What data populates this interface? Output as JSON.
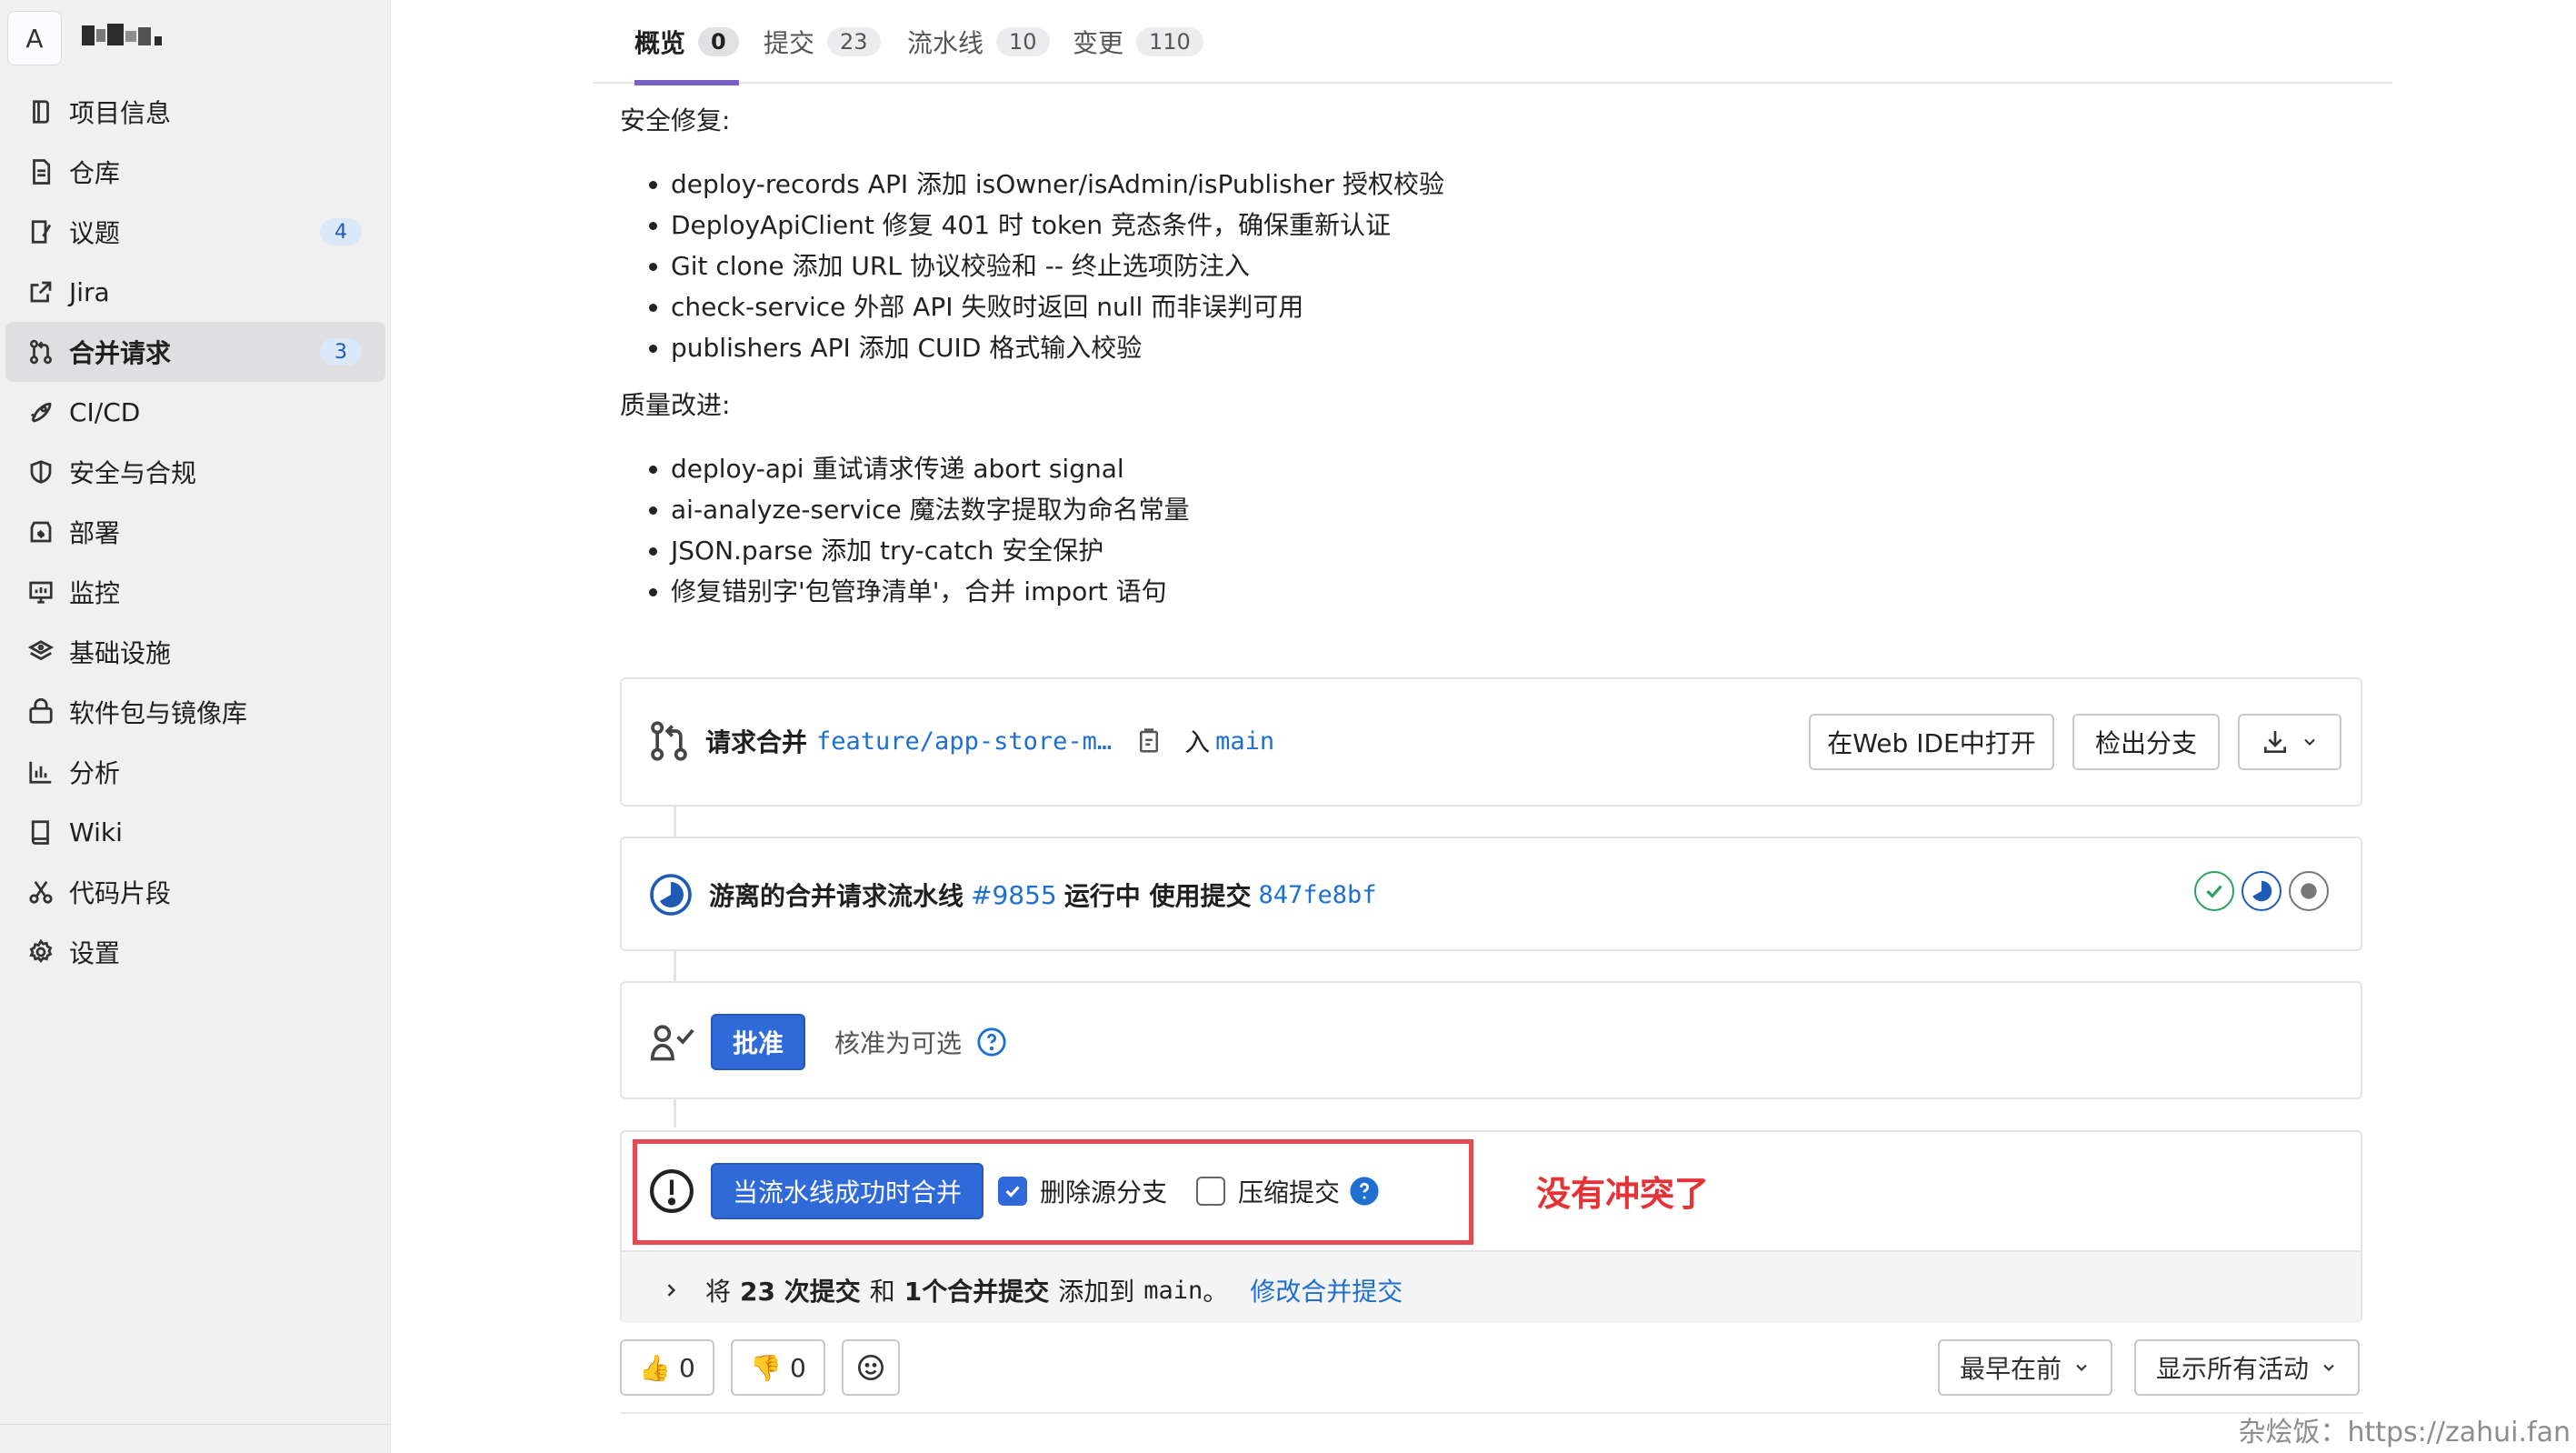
{
  "project": {
    "avatar_letter": "A"
  },
  "sidebar": {
    "items": [
      {
        "label": "项目信息",
        "icon": "project-info-icon"
      },
      {
        "label": "仓库",
        "icon": "repository-icon"
      },
      {
        "label": "议题",
        "icon": "issues-icon",
        "badge": "4"
      },
      {
        "label": "Jira",
        "icon": "external-link-icon"
      },
      {
        "label": "合并请求",
        "icon": "merge-request-icon",
        "badge": "3",
        "active": true
      },
      {
        "label": "CI/CD",
        "icon": "rocket-icon"
      },
      {
        "label": "安全与合规",
        "icon": "shield-icon"
      },
      {
        "label": "部署",
        "icon": "deployments-icon"
      },
      {
        "label": "监控",
        "icon": "monitor-icon"
      },
      {
        "label": "基础设施",
        "icon": "infrastructure-icon"
      },
      {
        "label": "软件包与镜像库",
        "icon": "package-icon"
      },
      {
        "label": "分析",
        "icon": "chart-icon"
      },
      {
        "label": "Wiki",
        "icon": "book-icon"
      },
      {
        "label": "代码片段",
        "icon": "scissors-icon"
      },
      {
        "label": "设置",
        "icon": "gear-icon"
      }
    ]
  },
  "tabs": [
    {
      "label": "概览",
      "count": "0",
      "active": true
    },
    {
      "label": "提交",
      "count": "23"
    },
    {
      "label": "流水线",
      "count": "10"
    },
    {
      "label": "变更",
      "count": "110"
    }
  ],
  "description": {
    "section1_title": "安全修复:",
    "section1_items": [
      "deploy-records API 添加 isOwner/isAdmin/isPublisher 授权校验",
      "DeployApiClient 修复 401 时 token 竞态条件，确保重新认证",
      "Git clone 添加 URL 协议校验和 -- 终止选项防注入",
      "check-service 外部 API 失败时返回 null 而非误判可用",
      "publishers API 添加 CUID 格式输入校验"
    ],
    "section2_title": "质量改进:",
    "section2_items": [
      "deploy-api 重试请求传递 abort signal",
      "ai-analyze-service 魔法数字提取为命名常量",
      "JSON.parse 添加 try-catch 安全保护",
      "修复错别字'包管琤清单'，合并 import 语句"
    ]
  },
  "branch": {
    "prefix": "请求合并",
    "source": "feature/app-store-m…",
    "into": "入",
    "target": "main",
    "web_ide": "在Web IDE中打开",
    "checkout": "检出分支"
  },
  "pipeline": {
    "text_prefix": "游离的合并请求流水线",
    "id": "#9855",
    "status": "运行中 使用提交",
    "sha": "847fe8bf",
    "stage_colors": {
      "passed": "#2da160",
      "running": "#1f5bb5",
      "pending": "#666666"
    }
  },
  "approval": {
    "button": "批准",
    "optional_text": "核准为可选"
  },
  "merge": {
    "button": "当流水线成功时合并",
    "delete_source": "删除源分支",
    "delete_checked": true,
    "squash": "压缩提交",
    "squash_checked": false,
    "annotation": "没有冲突了",
    "footer": {
      "p1": "将",
      "commits": "23 次提交",
      "p2": "和",
      "merge_commits": "1个合并提交",
      "p3": "添加到",
      "target": "main",
      "p4": "。",
      "modify": "修改合并提交"
    }
  },
  "reactions": {
    "thumbs_up": "👍 0",
    "thumbs_down": "👎 0"
  },
  "sorting": {
    "order": "最早在前",
    "filter": "显示所有活动"
  },
  "watermark": "杂烩饭：https://zahui.fan",
  "colors": {
    "primary": "#2f6ad8",
    "annotation": "#e63137",
    "link": "#1f6fd0"
  }
}
